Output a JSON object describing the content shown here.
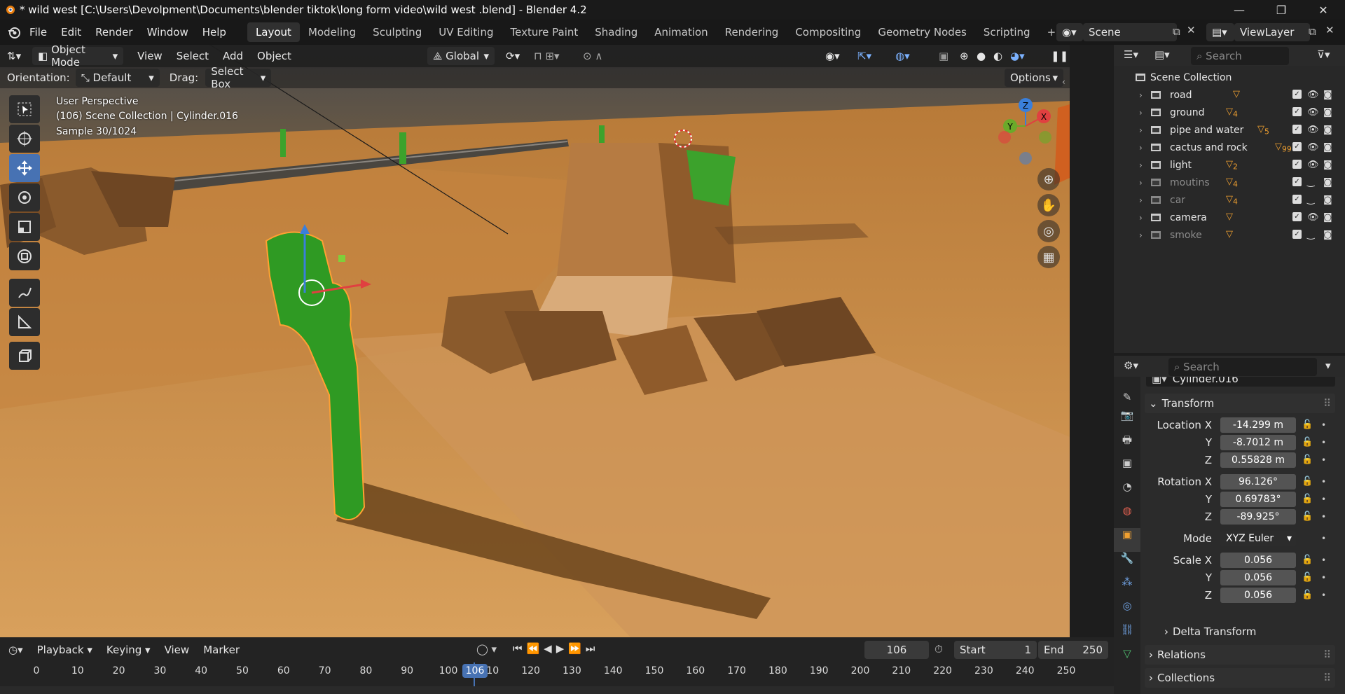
{
  "window": {
    "title": "* wild west  [C:\\Users\\Devolpment\\Documents\\blender tiktok\\long form video\\wild west .blend] - Blender 4.2"
  },
  "menu": {
    "items": [
      "File",
      "Edit",
      "Render",
      "Window",
      "Help"
    ]
  },
  "workspaces": [
    "Layout",
    "Modeling",
    "Sculpting",
    "UV Editing",
    "Texture Paint",
    "Shading",
    "Animation",
    "Rendering",
    "Compositing",
    "Geometry Nodes",
    "Scripting"
  ],
  "scene": {
    "name": "Scene",
    "view_layer": "ViewLayer"
  },
  "viewport": {
    "mode": "Object Mode",
    "header_menus": [
      "View",
      "Select",
      "Add",
      "Object"
    ],
    "transform_orientation": "Global",
    "orientation_label": "Orientation:",
    "orientation_value": "Default",
    "drag_label": "Drag:",
    "drag_value": "Select Box",
    "options_label": "Options",
    "overlay_line1": "User Perspective",
    "overlay_line2": "(106) Scene Collection | Cylinder.016",
    "overlay_line3": "Sample 30/1024",
    "gizmo": {
      "x": "X",
      "y": "Y",
      "z": "Z"
    }
  },
  "outliner": {
    "search_placeholder": "Search",
    "root": "Scene Collection",
    "collections": [
      {
        "name": "road",
        "badge": "",
        "dim": false
      },
      {
        "name": "ground",
        "badge": "4",
        "dim": false
      },
      {
        "name": "pipe and water",
        "badge": "5",
        "dim": false
      },
      {
        "name": "cactus and rock",
        "badge": "99",
        "dim": false
      },
      {
        "name": "light",
        "badge": "2",
        "dim": false
      },
      {
        "name": "moutins",
        "badge": "4",
        "dim": true
      },
      {
        "name": "car",
        "badge": "4",
        "dim": true
      },
      {
        "name": "camera",
        "badge": "",
        "dim": false
      },
      {
        "name": "smoke",
        "badge": "",
        "dim": true
      }
    ]
  },
  "properties": {
    "search_placeholder": "Search",
    "object_name": "Cylinder.016",
    "transform_label": "Transform",
    "location_label": "Location X",
    "location": {
      "x": "-14.299 m",
      "y": "-8.7012 m",
      "z": "0.55828 m"
    },
    "rotation_label": "Rotation X",
    "rotation": {
      "x": "96.126°",
      "y": "0.69783°",
      "z": "-89.925°"
    },
    "mode_label": "Mode",
    "mode_value": "XYZ Euler",
    "scale_label": "Scale X",
    "scale": {
      "x": "0.056",
      "y": "0.056",
      "z": "0.056"
    },
    "y_label": "Y",
    "z_label": "Z",
    "delta_label": "Delta Transform",
    "relations_label": "Relations",
    "collections_label": "Collections"
  },
  "timeline": {
    "menus": [
      "Playback",
      "Keying",
      "View",
      "Marker"
    ],
    "current_frame": "106",
    "start_label": "Start",
    "start_value": "1",
    "end_label": "End",
    "end_value": "250",
    "ticks": [
      "0",
      "10",
      "20",
      "30",
      "40",
      "50",
      "60",
      "70",
      "80",
      "90",
      "100",
      "110",
      "120",
      "130",
      "140",
      "150",
      "160",
      "170",
      "180",
      "190",
      "200",
      "210",
      "220",
      "230",
      "240",
      "250"
    ]
  },
  "colors": {
    "accent": "#4772b3",
    "selected_outline": "#ffa033",
    "ground": "#c8893f",
    "cactus": "#2f9a23"
  }
}
